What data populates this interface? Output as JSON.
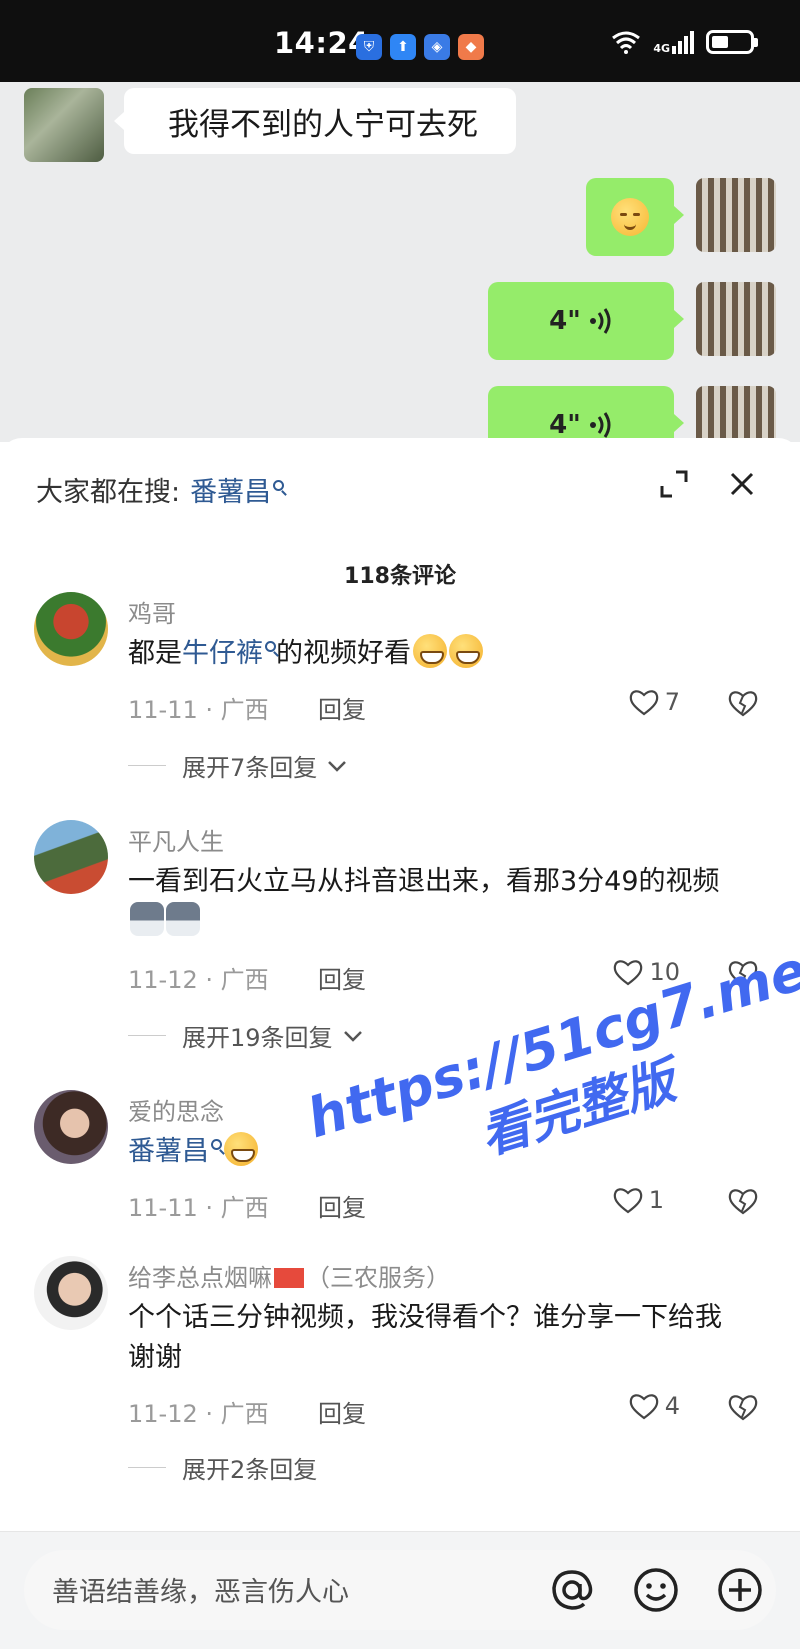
{
  "status_bar": {
    "time": "14:24",
    "network": "4G",
    "icons": [
      "shield-app-icon",
      "upload-app-icon",
      "cube-app-icon",
      "fox-app-icon",
      "wifi-icon",
      "signal-icon",
      "battery-icon"
    ]
  },
  "chat": {
    "incoming_text": "我得不到的人宁可去死",
    "outgoing": [
      {
        "type": "emoji",
        "emoji": "pensive-face-emoji"
      },
      {
        "type": "voice",
        "duration": "4\""
      },
      {
        "type": "voice",
        "duration": "4\""
      }
    ],
    "colors": {
      "incoming_bubble": "#ffffff",
      "outgoing_bubble": "#95ec6a",
      "background": "#ebeced"
    }
  },
  "comments_sheet": {
    "search_prefix": "大家都在搜:",
    "search_keyword": "番薯昌",
    "comment_count": "118条评论",
    "comments": [
      {
        "username": "鸡哥",
        "text_before": "都是",
        "link": "牛仔裤",
        "text_after": "的视频好看",
        "date": "11-11 · 广西",
        "reply": "回复",
        "likes": "7",
        "expand": "展开7条回复"
      },
      {
        "username": "平凡人生",
        "text": "一看到石火立马从抖音退出来，看那3分49的视频",
        "date": "11-12 · 广西",
        "reply": "回复",
        "likes": "10",
        "expand": "展开19条回复"
      },
      {
        "username": "爱的思念",
        "link": "番薯昌",
        "date": "11-11 · 广西",
        "reply": "回复",
        "likes": "1"
      },
      {
        "username": "给李总点烟嘛",
        "username_suffix": "（三农服务）",
        "text": "个个话三分钟视频，我没得看个？谁分享一下给我谢谢",
        "date": "11-12 · 广西",
        "reply": "回复",
        "likes": "4",
        "expand": "展开2条回复"
      }
    ],
    "link_color": "#2f5a93"
  },
  "watermark": {
    "line1": "https://51cg7.me",
    "line2": "看完整版",
    "color": "#4169f0"
  },
  "input": {
    "placeholder": "善语结善缘，恶言伤人心"
  }
}
